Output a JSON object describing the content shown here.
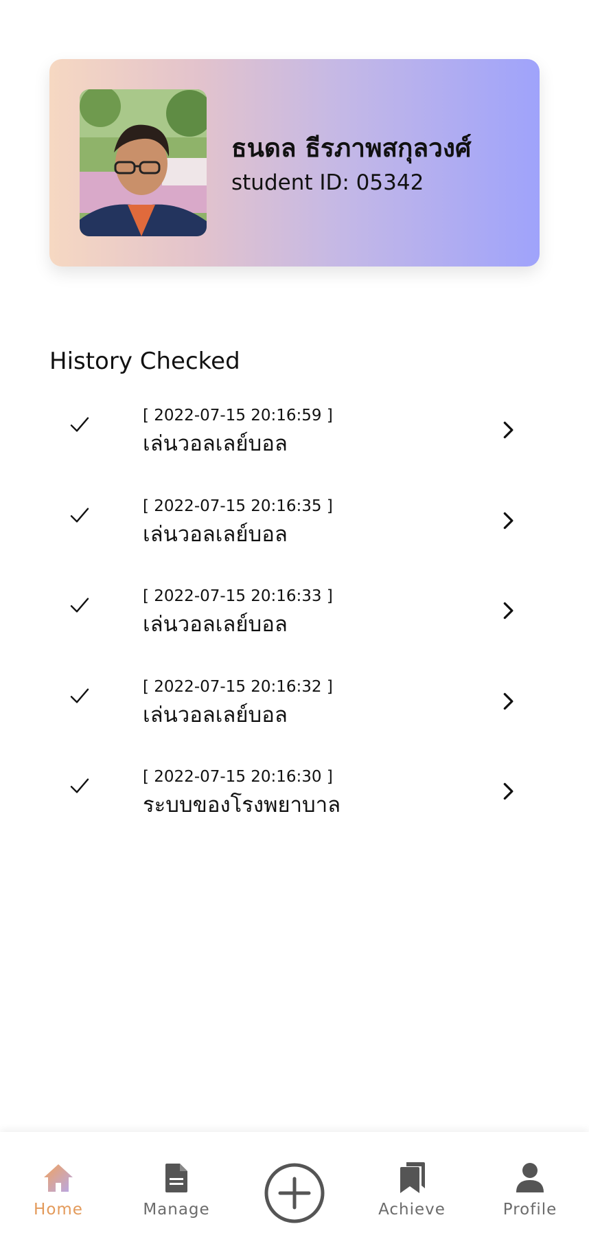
{
  "profile": {
    "name": "ธนดล ธีรภาพสกุลวงศ์",
    "student_id": "student ID: 05342"
  },
  "history": {
    "title": "History Checked",
    "items": [
      {
        "time": "[ 2022-07-15 20:16:59 ]",
        "title": "เล่นวอลเลย์บอล"
      },
      {
        "time": "[ 2022-07-15 20:16:35 ]",
        "title": "เล่นวอลเลย์บอล"
      },
      {
        "time": "[ 2022-07-15 20:16:33 ]",
        "title": "เล่นวอลเลย์บอล"
      },
      {
        "time": "[ 2022-07-15 20:16:32 ]",
        "title": "เล่นวอลเลย์บอล"
      },
      {
        "time": "[ 2022-07-15 20:16:30 ]",
        "title": "ระบบของโรงพยาบาล"
      }
    ]
  },
  "nav": {
    "items": [
      {
        "label": "Home",
        "icon": "home-icon",
        "active": true
      },
      {
        "label": "Manage",
        "icon": "document-icon",
        "active": false
      },
      {
        "label": "",
        "icon": "add-circle-icon",
        "active": false
      },
      {
        "label": "Achieve",
        "icon": "bookmarks-icon",
        "active": false
      },
      {
        "label": "Profile",
        "icon": "person-icon",
        "active": false
      }
    ]
  },
  "colors": {
    "accent": "#e39a5a",
    "card_gradient_start": "#f6d8c2",
    "card_gradient_end": "#9fa3fb",
    "nav_icon": "#555555"
  }
}
